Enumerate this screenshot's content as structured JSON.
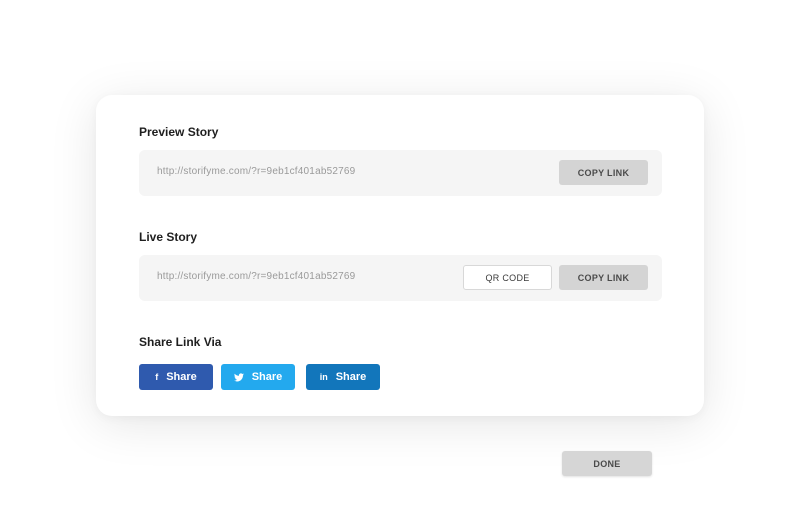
{
  "preview": {
    "title": "Preview Story",
    "url": "http://storifyme.com/?r=9eb1cf401ab52769",
    "copy_label": "COPY LINK"
  },
  "live": {
    "title": "Live Story",
    "url": "http://storifyme.com/?r=9eb1cf401ab52769",
    "qr_label": "QR CODE",
    "copy_label": "COPY LINK"
  },
  "share": {
    "title": "Share Link Via",
    "buttons": [
      {
        "network": "facebook",
        "icon": "f",
        "label": "Share",
        "color": "#2f5aae"
      },
      {
        "network": "twitter",
        "icon": "twitter-bird",
        "label": "Share",
        "color": "#23a9ee"
      },
      {
        "network": "linkedin",
        "icon": "in",
        "label": "Share",
        "color": "#1276bb"
      }
    ]
  },
  "done_label": "DONE"
}
